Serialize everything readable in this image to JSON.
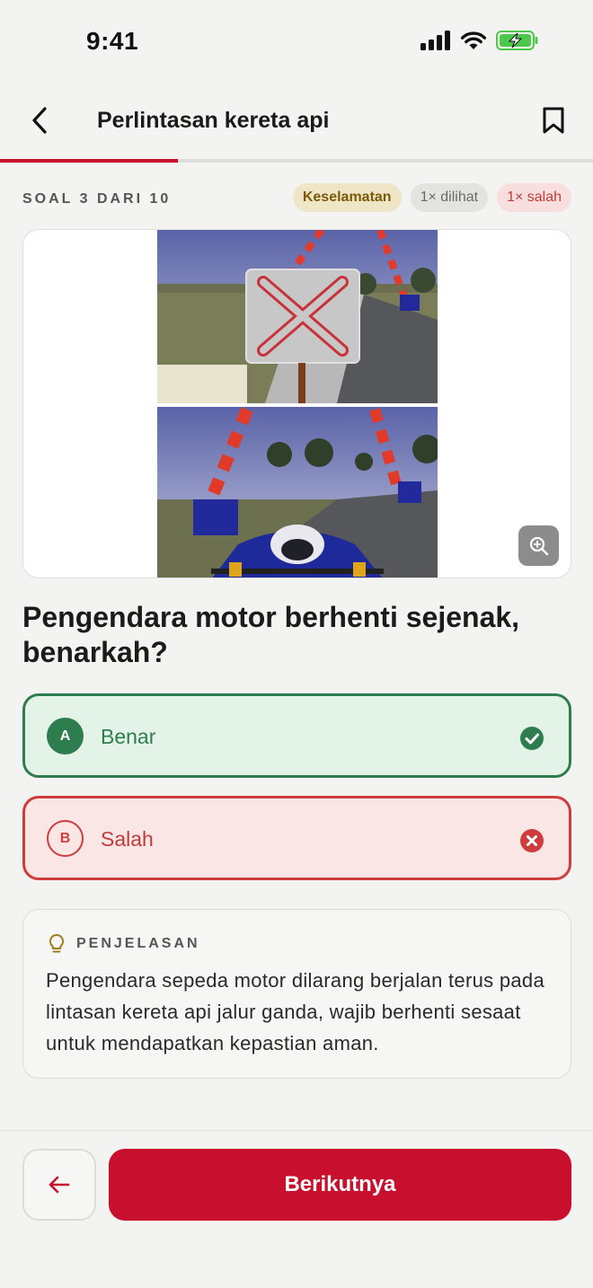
{
  "status_bar": {
    "time": "9:41"
  },
  "header": {
    "title": "Perlintasan kereta api"
  },
  "progress": {
    "current": 3,
    "total": 10,
    "fraction": 0.3
  },
  "meta": {
    "soal_label": "SOAL 3 DARI 10",
    "chips": {
      "category": "Keselamatan",
      "views": "1× dilihat",
      "wrong": "1× salah"
    }
  },
  "question": {
    "text": "Pengendara motor berhenti sejenak, benarkah?"
  },
  "options": [
    {
      "letter": "A",
      "label": "Benar",
      "state": "correct"
    },
    {
      "letter": "B",
      "label": "Salah",
      "state": "wrong"
    }
  ],
  "explanation": {
    "label": "PENJELASAN",
    "text": "Pengendara sepeda motor dilarang berjalan terus pada lintasan kereta api jalur ganda, wajib berhenti sesaat untuk mendapatkan kepastian aman."
  },
  "footer": {
    "next_label": "Berikutnya"
  },
  "icons": {
    "back": "chevron-left-icon",
    "bookmark": "bookmark-icon",
    "zoom": "zoom-in-icon",
    "correct": "check-circle-icon",
    "wrong": "x-circle-icon",
    "hint": "lightbulb-icon",
    "prev": "arrow-left-icon"
  },
  "colors": {
    "accent": "#c8102e",
    "correct": "#2e7d4f",
    "wrong": "#cf3c3c",
    "chip_category": "#7a5a06"
  }
}
